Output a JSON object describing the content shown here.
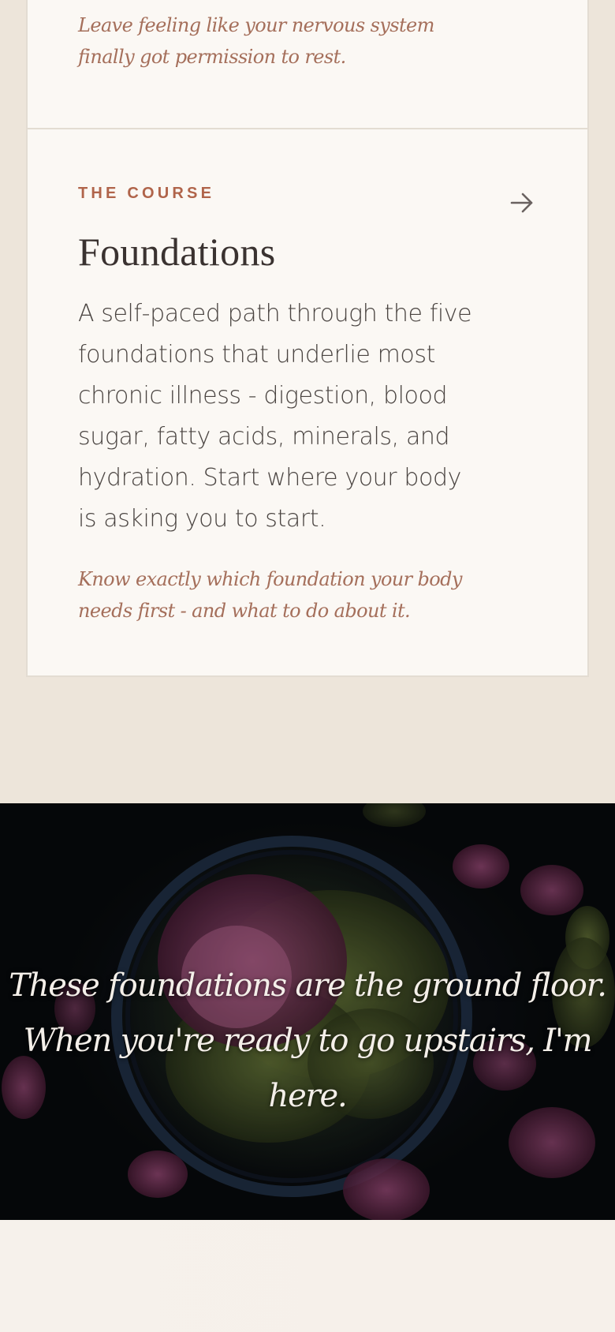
{
  "top_card": {
    "tagline": "Leave feeling like your nervous system finally got permission to rest."
  },
  "course_card": {
    "eyebrow": "THE COURSE",
    "title": "Foundations",
    "description": "A self-paced path through the five foundations that underlie most chronic illness - digestion, blood sugar, fatty acids, minerals, and hydration. Start where your body is asking you to start.",
    "tagline": "Know exactly which foundation your body needs first - and what to do about it.",
    "icon": "arrow-right-icon"
  },
  "hero": {
    "quote_line1": "These foundations are the ground floor.",
    "quote_line2": "When you're ready to go upstairs, I'm here.",
    "image": "bowl-of-radicchio-leaves"
  },
  "colors": {
    "page_bg": "#ede5da",
    "card_bg": "#fbf8f4",
    "accent": "#b0644a",
    "tagline": "#a56f5b",
    "text": "#4a4441"
  }
}
